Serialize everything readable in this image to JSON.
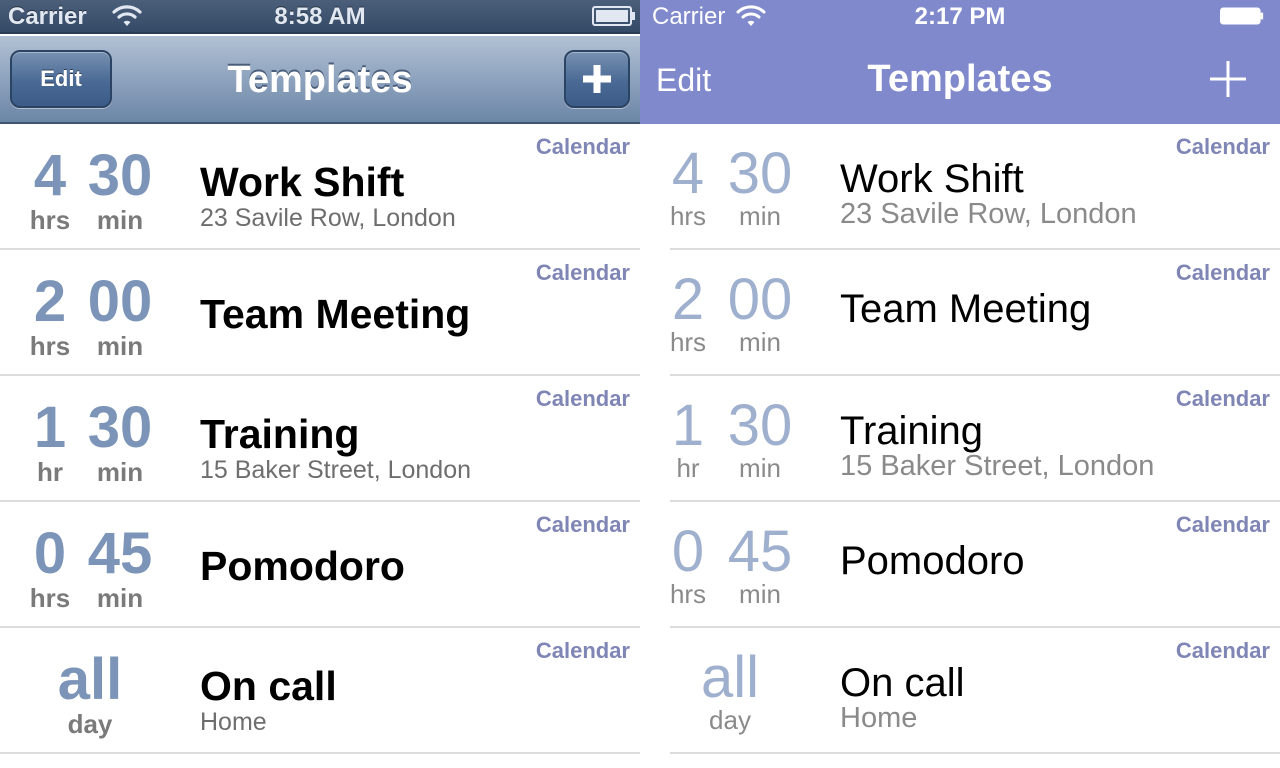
{
  "ios6": {
    "status": {
      "carrier": "Carrier",
      "time": "8:58 AM"
    },
    "nav": {
      "edit_label": "Edit",
      "title": "Templates"
    }
  },
  "ios7": {
    "status": {
      "carrier": "Carrier",
      "time": "2:17 PM"
    },
    "nav": {
      "edit_label": "Edit",
      "title": "Templates"
    }
  },
  "templates": [
    {
      "hours": "4",
      "minutes": "30",
      "hours_unit": "hrs",
      "minutes_unit": "min",
      "title": "Work Shift",
      "subtitle": "23 Savile Row, London",
      "calendar": "Calendar"
    },
    {
      "hours": "2",
      "minutes": "00",
      "hours_unit": "hrs",
      "minutes_unit": "min",
      "title": "Team Meeting",
      "subtitle": "",
      "calendar": "Calendar"
    },
    {
      "hours": "1",
      "minutes": "30",
      "hours_unit": "hr",
      "minutes_unit": "min",
      "title": "Training",
      "subtitle": "15 Baker Street, London",
      "calendar": "Calendar"
    },
    {
      "hours": "0",
      "minutes": "45",
      "hours_unit": "hrs",
      "minutes_unit": "min",
      "title": "Pomodoro",
      "subtitle": "",
      "calendar": "Calendar"
    },
    {
      "all_day_top": "all",
      "all_day_bottom": "day",
      "title": "On call",
      "subtitle": "Home",
      "calendar": "Calendar"
    }
  ],
  "icons": {
    "wifi": "wifi-icon",
    "battery": "battery-icon",
    "add": "plus-icon"
  },
  "colors": {
    "ios7_accent": "#8089cc",
    "duration_blue": "#7b94b8",
    "calendar_label": "#7f86b5"
  }
}
